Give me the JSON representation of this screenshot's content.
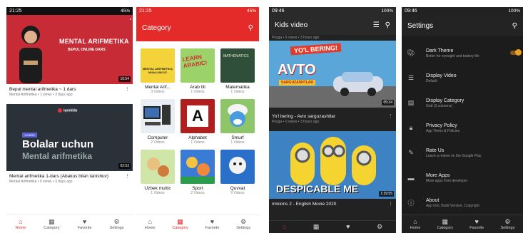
{
  "colors": {
    "accent": "#e52a2a",
    "dark_bg": "#1c1c1c",
    "toggle": "#f0a020"
  },
  "phone1": {
    "status": {
      "time": "21:25",
      "right": "45%"
    },
    "video1": {
      "overlay_title": "MENTAL ARIFMETIKA",
      "overlay_sub": "BEPUL ONLINE DARS",
      "duration": "10:54",
      "title": "Bepul mental arifmetika ~ 1 dars",
      "meta": "Mental Arifmetika  •  1 views  •  3 days ago"
    },
    "video2": {
      "brand": "iqrokids",
      "chip": "1-DARS",
      "overlay_big": "Bolalar uchun",
      "overlay_sub": "Mental arifmetika",
      "duration": "02:53",
      "title": "Mental arifmetika 1-dars (Abakus bilan tanishuv)",
      "meta": "Mental Arifmetika  •  0 views  •  3 days ago"
    },
    "nav": [
      {
        "label": "Home",
        "icon": "home-icon"
      },
      {
        "label": "Category",
        "icon": "grid-icon"
      },
      {
        "label": "Favorite",
        "icon": "heart-icon"
      },
      {
        "label": "Settings",
        "icon": "gear-icon"
      }
    ]
  },
  "phone2": {
    "status": {
      "time": "21:25",
      "right": "45%"
    },
    "title": "Category",
    "categories": [
      {
        "name": "Mental Arif...",
        "count": "3 Videos",
        "thumb": "MENTAL ARIFMETIKA MUALLIMI UZ"
      },
      {
        "name": "Arab tili",
        "count": "1 Videos",
        "thumb": "LEARN ARABIC!"
      },
      {
        "name": "Matematika",
        "count": "1 Videos",
        "thumb": "MATHEMATICS"
      },
      {
        "name": "Computer",
        "count": "2 Videos",
        "thumb": ""
      },
      {
        "name": "Alphabet",
        "count": "1 Videos",
        "thumb": "A"
      },
      {
        "name": "Smurf",
        "count": "1 Videos",
        "thumb": ""
      },
      {
        "name": "Uzbek multic",
        "count": "1 Videos",
        "thumb": ""
      },
      {
        "name": "Sport",
        "count": "2 Videos",
        "thumb": ""
      },
      {
        "name": "Quvvat",
        "count": "6 Videos",
        "thumb": ""
      }
    ],
    "nav": [
      {
        "label": "Home",
        "icon": "home-icon"
      },
      {
        "label": "Category",
        "icon": "grid-icon"
      },
      {
        "label": "Favorite",
        "icon": "heart-icon"
      },
      {
        "label": "Settings",
        "icon": "gear-icon"
      }
    ]
  },
  "phone3": {
    "status": {
      "time": "09:46",
      "right": "100%"
    },
    "title": "Kids video",
    "prev_meta": "Poyga  •  5 views  •  3 hours ago",
    "video1": {
      "overlay_top": "YO'L BERING!",
      "overlay_big": "AVTO",
      "overlay_sub": "SARGUZASHTLAR",
      "duration": "05:34",
      "title": "Yo'l bering - Avto sarguzashtlar",
      "meta": "Poyga  •  0 views  •  3 hours ago"
    },
    "video2": {
      "overlay": "DESPICABLE ME",
      "duration": "1:39:55",
      "title": "minions 2 - English Movie 2020"
    },
    "nav": [
      {
        "label": "Home",
        "icon": "home-icon"
      },
      {
        "label": "Category",
        "icon": "grid-icon"
      },
      {
        "label": "Favorite",
        "icon": "heart-icon"
      },
      {
        "label": "Settings",
        "icon": "gear-icon"
      }
    ]
  },
  "phone4": {
    "status": {
      "time": "09:46",
      "right": "100%"
    },
    "title": "Settings",
    "items": [
      {
        "icon": "palette-icon",
        "title": "Dark Theme",
        "sub": "Better for eyesight and battery life"
      },
      {
        "icon": "list-icon",
        "title": "Display Video",
        "sub": "Default"
      },
      {
        "icon": "category-icon",
        "title": "Display Category",
        "sub": "Grid (3 columns)"
      },
      {
        "icon": "lock-icon",
        "title": "Privacy Policy",
        "sub": "App Terms & Policies"
      },
      {
        "icon": "rate-icon",
        "title": "Rate Us",
        "sub": "Leave a review on the Google Play"
      },
      {
        "icon": "more-apps-icon",
        "title": "More Apps",
        "sub": "More apps from developer"
      },
      {
        "icon": "info-icon",
        "title": "About",
        "sub": "App Info, Build Version, Copyright"
      }
    ],
    "nav": [
      {
        "label": "Home",
        "icon": "home-icon"
      },
      {
        "label": "Category",
        "icon": "grid-icon"
      },
      {
        "label": "Favorite",
        "icon": "heart-icon"
      },
      {
        "label": "Settings",
        "icon": "gear-icon"
      }
    ]
  }
}
